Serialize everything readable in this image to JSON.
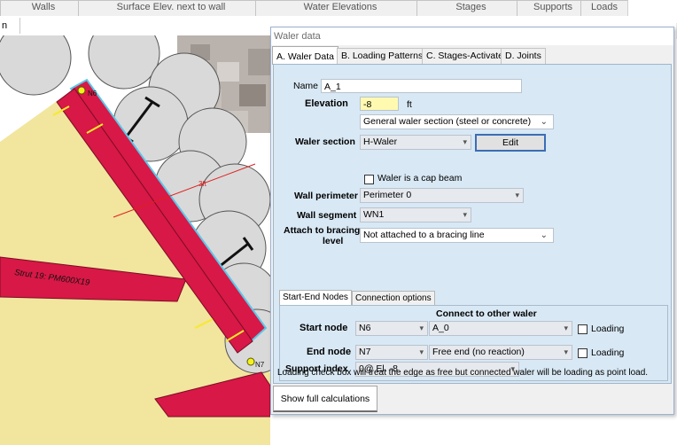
{
  "toolbar": {
    "tabs": [
      "Walls",
      "Surface Elev. next to wall",
      "Water Elevations",
      "Stages",
      "Supports",
      "Loads"
    ]
  },
  "left_tab": "n",
  "canvas": {
    "strut_label": "Strut 19: PM600X19",
    "dimension_label": "3ft",
    "node_n6": "N6",
    "node_n7": "N7",
    "colors": {
      "waler": "#d81846",
      "soil": "#f2e59e",
      "waler_outline": "#5ac8e8"
    }
  },
  "dialog": {
    "title": "Waler data",
    "tabs": [
      "A. Waler Data",
      "B. Loading Patterns",
      "C. Stages-Activate",
      "D. Joints"
    ],
    "active_tab": 0,
    "name_label": "Name",
    "name_value": "A_1",
    "elevation_label": "Elevation",
    "elevation_value": "-8",
    "elevation_unit": "ft",
    "section_type": "General waler section (steel or concrete)",
    "waler_section_label": "Waler section",
    "waler_section_value": "H-Waler",
    "edit_button": "Edit",
    "cap_beam_label": "Waler is a cap beam",
    "wall_perimeter_label": "Wall perimeter",
    "wall_perimeter_value": "Perimeter 0",
    "wall_segment_label": "Wall segment",
    "wall_segment_value": "WN1",
    "attach_label_1": "Attach to bracing",
    "attach_label_2": "level",
    "attach_value": "Not attached to a bracing line",
    "subtabs": [
      "Start-End Nodes",
      "Connection options"
    ],
    "connect_header": "Connect to other waler",
    "start_node_label": "Start node",
    "start_node_value": "N6",
    "start_connect_value": "A_0",
    "loading_label": "Loading",
    "end_node_label": "End node",
    "end_node_value": "N7",
    "end_connect_value": "Free end (no reaction)",
    "support_index_label": "Support index",
    "support_index_value": "0@ El. -8",
    "note": "Loading check box will treat the edge as free but connected waler will be loading as point load.",
    "show_calc_button": "Show full calculations"
  }
}
